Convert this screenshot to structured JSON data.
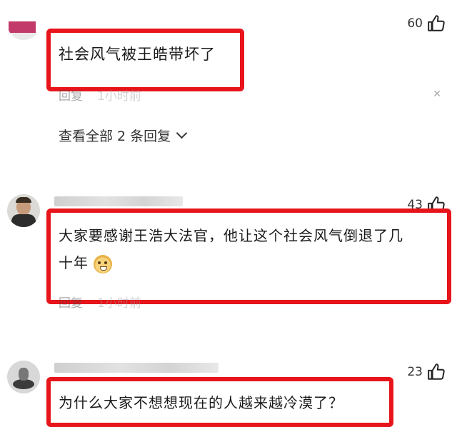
{
  "comments": [
    {
      "likes": "60",
      "text": "社会风气被王皓带坏了",
      "reply_label": "回复",
      "time": "1小时前",
      "view_replies": "查看全部 2 条回复",
      "avatar_color": "#c23a6a"
    },
    {
      "likes": "43",
      "text_line1": "大家要感谢王浩大法官，他让这个社会风气倒退了几",
      "text_line2": "十年",
      "emoji": "doge-emoji",
      "reply_label": "回复",
      "time": "1小时前"
    },
    {
      "likes": "23",
      "text": "为什么大家不想想现在的人越来越冷漠了？"
    }
  ],
  "colors": {
    "highlight": "#e8141b",
    "background": "#ffffff"
  }
}
